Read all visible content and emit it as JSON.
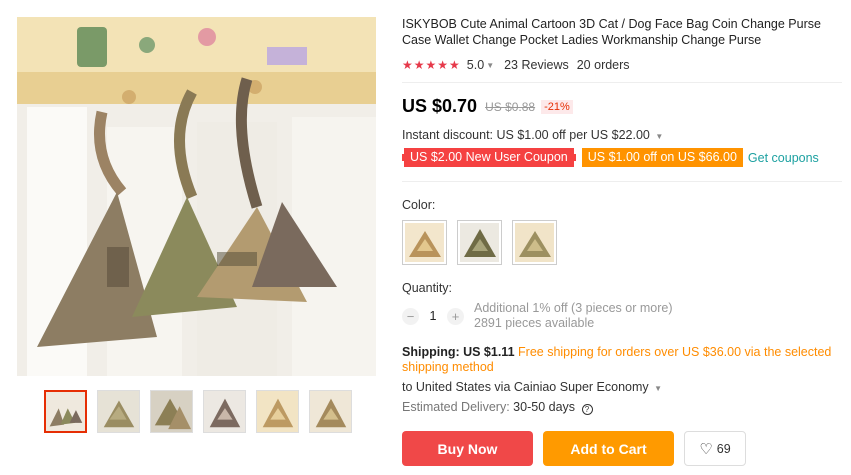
{
  "product": {
    "title": "ISKYBOB Cute Animal Cartoon 3D Cat / Dog Face Bag Coin Change Purse Case Wallet Change Pocket Ladies Workmanship Change Purse",
    "stars": "★★★★★",
    "rating": "5.0",
    "reviews": "23 Reviews",
    "orders": "20 orders"
  },
  "price": {
    "current": "US $0.70",
    "original": "US $0.88",
    "discount": "-21%",
    "instant_discount": "Instant discount: US $1.00 off per US $22.00"
  },
  "coupons": {
    "new_user": "US $2.00 New User Coupon",
    "store": "US $1.00 off on US $66.00",
    "get_link": "Get coupons"
  },
  "options": {
    "color_label": "Color:",
    "quantity_label": "Quantity:",
    "quantity_value": "1",
    "qty_minus": "−",
    "qty_plus": "+",
    "additional_discount": "Additional 1% off (3 pieces or more)",
    "available": "2891 pieces available"
  },
  "shipping": {
    "label": "Shipping: US $1.11",
    "free_note": "Free shipping for orders over US $36.00 via the selected shipping method",
    "destination": "to United States via Cainiao Super Economy",
    "delivery_label": "Estimated Delivery:",
    "delivery_value": "30-50 days"
  },
  "actions": {
    "buy_now": "Buy Now",
    "add_to_cart": "Add to Cart",
    "wishlist_count": "69"
  },
  "colors": {
    "accent_red": "#f04848",
    "accent_orange": "#ff9a00",
    "link_teal": "#1da1a1"
  }
}
